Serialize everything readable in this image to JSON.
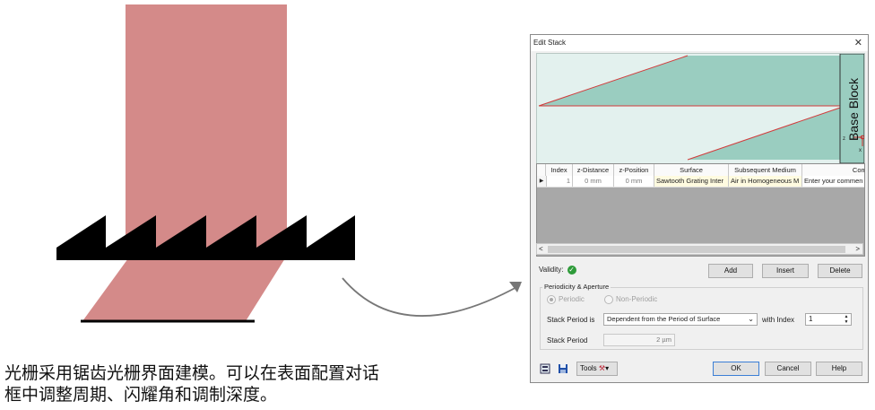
{
  "caption": {
    "line1": "光栅采用锯齿光栅界面建模。可以在表面配置对话",
    "line2": "框中调整周期、闪耀角和调制深度。"
  },
  "colors": {
    "beam": "#d48a89",
    "grating": "#000000",
    "preview_fill": "#9acdc0",
    "preview_bg": "#e3f1ee",
    "preview_line": "#d23b3b",
    "ok_border": "#3c7fd6",
    "validity_green": "#2e9b3a"
  },
  "dialog": {
    "title": "Edit Stack",
    "close_icon": "close-icon",
    "preview": {
      "label": "Base Block",
      "axis_z": "z",
      "axis_x": "x"
    },
    "table": {
      "columns": [
        "Index",
        "z-Distance",
        "z-Position",
        "Surface",
        "Subsequent Medium",
        "Comm"
      ],
      "rows": [
        {
          "index": "1",
          "z_distance": "0 mm",
          "z_position": "0 mm",
          "surface": "Sawtooth Grating Inter",
          "medium": "Air in Homogeneous M",
          "comment": "Enter your commen"
        }
      ],
      "scroll_left": "<",
      "scroll_right": ">"
    },
    "validity_label": "Validity:",
    "validity_icon": "check-icon",
    "buttons": {
      "add": "Add",
      "insert": "Insert",
      "delete": "Delete",
      "ok": "OK",
      "cancel": "Cancel",
      "help": "Help"
    },
    "group_title": "Periodicity & Aperture",
    "radio_periodic": "Periodic",
    "radio_non_periodic": "Non-Periodic",
    "stack_period_is_label": "Stack Period is",
    "stack_period_is_value": "Dependent from the Period of Surface",
    "with_index_label": "with Index",
    "with_index_value": "1",
    "stack_period_label": "Stack Period",
    "stack_period_value": "2 µm",
    "tools_label": "Tools"
  }
}
